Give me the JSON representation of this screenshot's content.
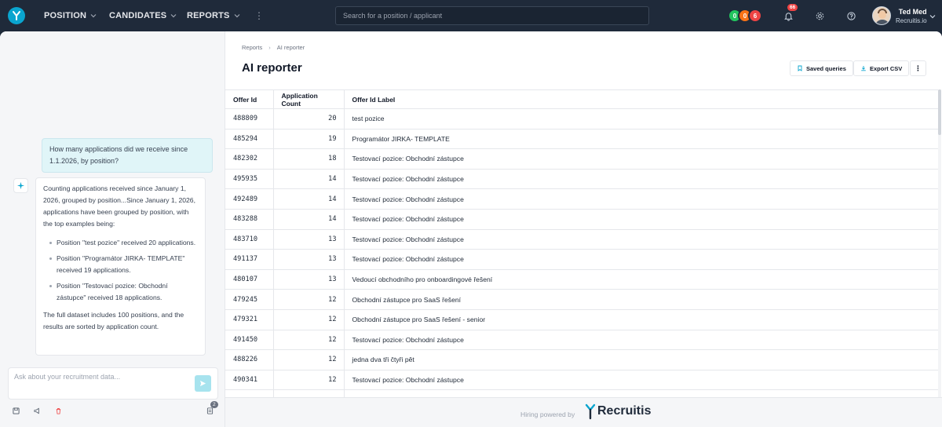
{
  "nav": {
    "items": [
      {
        "label": "POSITION"
      },
      {
        "label": "CANDIDATES"
      },
      {
        "label": "REPORTS"
      }
    ],
    "search_placeholder": "Search for a position / applicant",
    "status_counts": [
      {
        "value": "0",
        "color": "#22c55e"
      },
      {
        "value": "0",
        "color": "#f97316"
      },
      {
        "value": "6",
        "color": "#ef4444"
      }
    ],
    "notification_count": "66",
    "user_name": "Ted Med",
    "user_org": "Recruitis.io"
  },
  "chat": {
    "user_message": "How many applications did we receive since 1.1.2026, by position?",
    "ai_intro": "Counting applications received since January 1, 2026, grouped by position...Since January 1, 2026, applications have been grouped by position, with the top examples being:",
    "ai_points": [
      "Position \"test pozice\" received 20 applications.",
      "Position \"Programátor JIRKA- TEMPLATE\" received 19 applications.",
      "Position \"Testovací pozice: Obchodní zástupce\" received 18 applications."
    ],
    "ai_outro": "The full dataset includes 100 positions, and the results are sorted by application count.",
    "input_placeholder": "Ask about your recruitment data...",
    "history_count": "2"
  },
  "report": {
    "breadcrumb": [
      "Reports",
      "AI reporter"
    ],
    "title": "AI reporter",
    "saved_queries_label": "Saved queries",
    "export_label": "Export CSV",
    "columns": [
      "Offer Id",
      "Application Count",
      "Offer Id Label"
    ],
    "rows": [
      {
        "id": "488809",
        "count": "20",
        "label": "test pozice"
      },
      {
        "id": "485294",
        "count": "19",
        "label": "Programátor JIRKA- TEMPLATE"
      },
      {
        "id": "482302",
        "count": "18",
        "label": "Testovací pozice: Obchodní zástupce"
      },
      {
        "id": "495935",
        "count": "14",
        "label": "Testovací pozice: Obchodní zástupce"
      },
      {
        "id": "492489",
        "count": "14",
        "label": "Testovací pozice: Obchodní zástupce"
      },
      {
        "id": "483288",
        "count": "14",
        "label": "Testovací pozice: Obchodní zástupce"
      },
      {
        "id": "483710",
        "count": "13",
        "label": "Testovací pozice: Obchodní zástupce"
      },
      {
        "id": "491137",
        "count": "13",
        "label": "Testovací pozice: Obchodní zástupce"
      },
      {
        "id": "480107",
        "count": "13",
        "label": "Vedoucí obchodního pro onboardingové řešení"
      },
      {
        "id": "479245",
        "count": "12",
        "label": "Obchodní zástupce pro SaaS řešení"
      },
      {
        "id": "479321",
        "count": "12",
        "label": "Obchodní zástupce pro SaaS řešení - senior"
      },
      {
        "id": "491450",
        "count": "12",
        "label": "Testovací pozice: Obchodní zástupce"
      },
      {
        "id": "488226",
        "count": "12",
        "label": "jedna dva tři čtyři pět"
      },
      {
        "id": "490341",
        "count": "12",
        "label": "Testovací pozice: Obchodní zástupce"
      },
      {
        "id": "",
        "count": "",
        "label": ""
      }
    ],
    "footer_text": "Hiring powered by",
    "footer_brand": "Recruitis"
  }
}
